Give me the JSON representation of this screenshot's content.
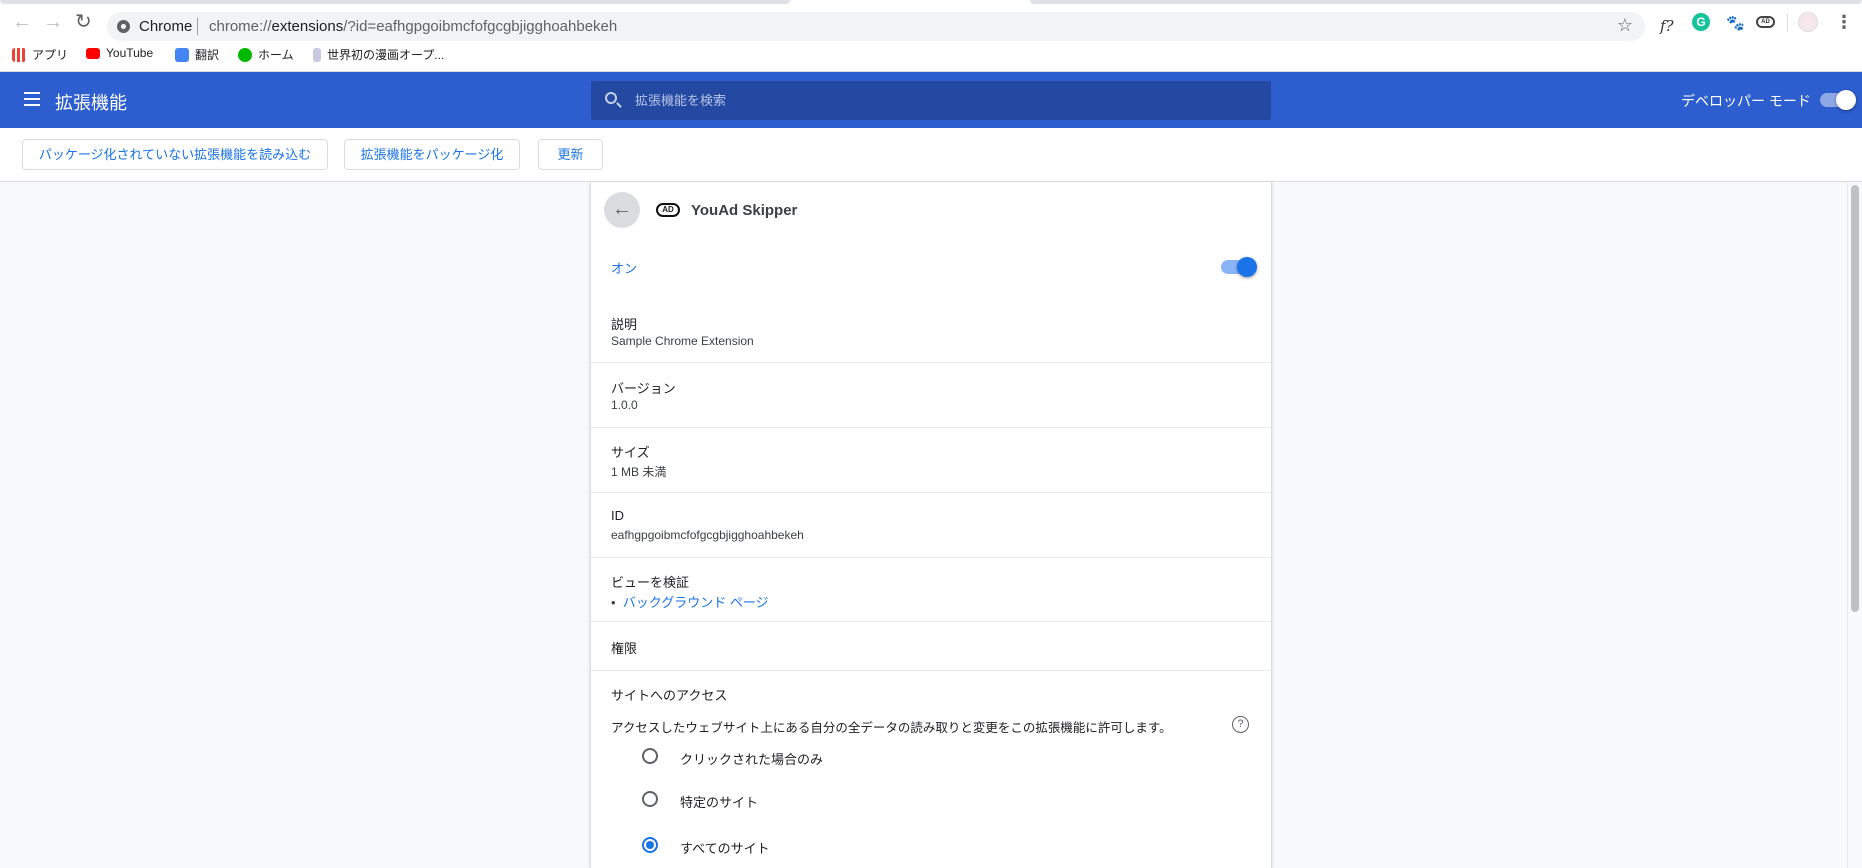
{
  "browser": {
    "site_label": "Chrome",
    "url_prefix": "chrome://",
    "url_host": "extensions",
    "url_rest": "/?id=eafhgpgoibmcfofgcgbjigghoahbekeh",
    "extension_icons": [
      "f?",
      "G",
      "paw",
      "AD"
    ],
    "bookmarks": [
      {
        "label": "アプリ",
        "icon": "apps-grid-icon",
        "color": "#ea4335"
      },
      {
        "label": "YouTube",
        "icon": "youtube-icon",
        "color": "#ff0000"
      },
      {
        "label": "翻訳",
        "icon": "translate-icon",
        "color": "#4285f4"
      },
      {
        "label": "ホーム",
        "icon": "line-icon",
        "color": "#00b900"
      },
      {
        "label": "世界初の漫画オープ...",
        "icon": "manga-icon",
        "color": "#6a6aa8"
      }
    ]
  },
  "header": {
    "title": "拡張機能",
    "search_placeholder": "拡張機能を検索",
    "dev_mode_label": "デベロッパー モード",
    "dev_mode_on": true
  },
  "actions": {
    "load_unpacked": "パッケージ化されていない拡張機能を読み込む",
    "pack": "拡張機能をパッケージ化",
    "update": "更新"
  },
  "detail": {
    "name": "YouAd Skipper",
    "icon_text": "AD",
    "enabled_label": "オン",
    "enabled": true,
    "description_label": "説明",
    "description": "Sample Chrome Extension",
    "version_label": "バージョン",
    "version": "1.0.0",
    "size_label": "サイズ",
    "size": "1 MB 未満",
    "id_label": "ID",
    "id": "eafhgpgoibmcfofgcgbjigghoahbekeh",
    "views_label": "ビューを検証",
    "views": [
      "バックグラウンド ページ"
    ],
    "permissions_label": "権限",
    "site_access_label": "サイトへのアクセス",
    "site_access_desc": "アクセスしたウェブサイト上にある自分の全データの読み取りと変更をこの拡張機能に許可します。",
    "help": "?",
    "options": [
      {
        "label": "クリックされた場合のみ",
        "selected": false
      },
      {
        "label": "特定のサイト",
        "selected": false
      },
      {
        "label": "すべてのサイト",
        "selected": true
      }
    ]
  }
}
